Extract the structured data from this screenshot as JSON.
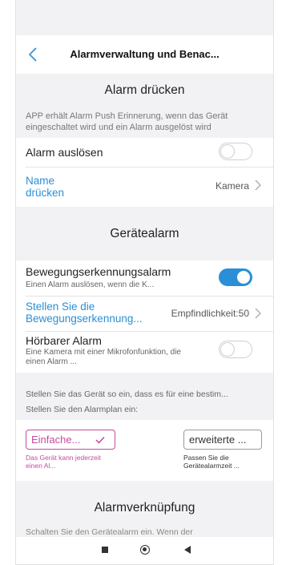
{
  "header": {
    "title": "Alarmverwaltung und Benac..."
  },
  "alarm_press": {
    "heading": "Alarm drücken",
    "description": "APP erhält Alarm Push Erinnerung, wenn das Gerät eingeschaltet wird und ein Alarm ausgelöst wird",
    "trigger_label": "Alarm auslösen",
    "trigger_on": false,
    "name_label": "Name drücken",
    "name_value": "Kamera"
  },
  "device_alarm": {
    "heading": "Gerätealarm",
    "motion_label": "Bewegungserkennungsalarm",
    "motion_sub": "Einen Alarm auslösen, wenn die K...",
    "motion_on": true,
    "sensitivity_label": "Stellen Sie die Bewegungserkennung...",
    "sensitivity_value": "Empfindlichkeit:50",
    "audible_label": "Hörbarer Alarm",
    "audible_sub": "Eine Kamera mit einer Mikrofonfunktion, die einen Alarm ...",
    "audible_on": false
  },
  "schedule": {
    "line1": "Stellen Sie das Gerät so ein, dass es für eine bestim...",
    "line2": "Stellen Sie den Alarmplan ein:",
    "simple_label": "Einfache...",
    "simple_desc": "Das Gerät kann jederzeit einen Al...",
    "advanced_label": "erweiterte ...",
    "advanced_desc": "Passen Sie die Gerätealarmzeit ..."
  },
  "linkage": {
    "heading": "Alarmverknüpfung",
    "description": "Schalten Sie den Gerätealarm ein. Wenn der"
  },
  "icons": {
    "back": "chevron-left-icon",
    "chevron": "chevron-right-icon",
    "check": "check-icon",
    "nav_recent": "square-icon",
    "nav_home": "circle-icon",
    "nav_back": "triangle-left-icon"
  },
  "colors": {
    "accent": "#2a8fd6",
    "plan_accent": "#c84aa0"
  }
}
